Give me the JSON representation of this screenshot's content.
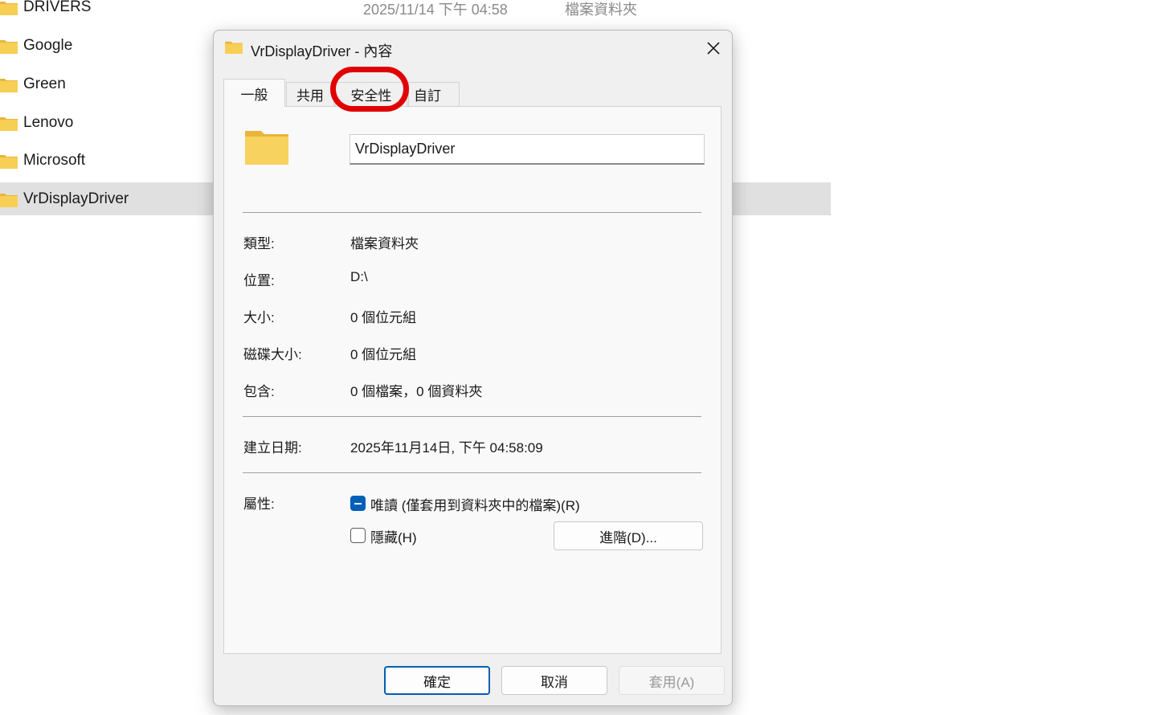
{
  "explorer": {
    "top_row": {
      "name": "DRIVERS",
      "date": "2025/11/14 下午 04:58",
      "type": "檔案資料夾"
    },
    "folders": [
      "Google",
      "Green",
      "Lenovo",
      "Microsoft",
      "VrDisplayDriver"
    ],
    "selected_folder": "VrDisplayDriver"
  },
  "dialog": {
    "title": "VrDisplayDriver - 內容",
    "tabs": [
      "一般",
      "共用",
      "安全性",
      "自訂"
    ],
    "active_tab": "一般",
    "highlighted_tab": "安全性",
    "folder_name": "VrDisplayDriver",
    "properties": {
      "type_label": "類型:",
      "type_value": "檔案資料夾",
      "location_label": "位置:",
      "location_value": "D:\\",
      "size_label": "大小:",
      "size_value": "0 個位元組",
      "disk_size_label": "磁碟大小:",
      "disk_size_value": "0 個位元組",
      "contains_label": "包含:",
      "contains_value": "0 個檔案，0 個資料夾",
      "created_label": "建立日期:",
      "created_value": "2025年11月14日, 下午 04:58:09",
      "attributes_label": "屬性:"
    },
    "attributes": {
      "readonly_label": "唯讀 (僅套用到資料夾中的檔案)(R)",
      "readonly_state": "indeterminate",
      "hidden_label": "隱藏(H)",
      "hidden_checked": false,
      "advanced_label": "進階(D)..."
    },
    "buttons": {
      "ok": "確定",
      "cancel": "取消",
      "apply": "套用(A)"
    },
    "colors": {
      "accent": "#005fb8",
      "highlight_ring": "#e00000"
    }
  }
}
